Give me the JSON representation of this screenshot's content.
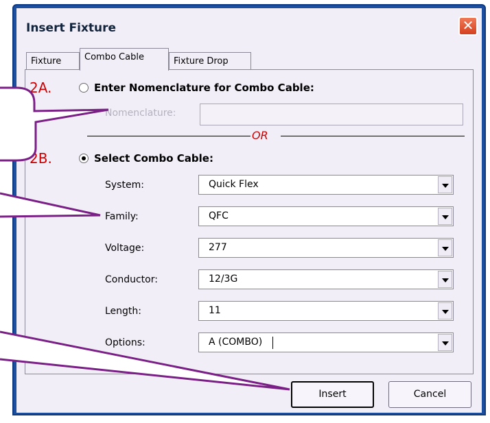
{
  "window": {
    "title": "Insert Fixture",
    "close_glyph": "✕"
  },
  "tabs": [
    {
      "label": "Fixture",
      "active": false
    },
    {
      "label": "Combo Cable",
      "active": true
    },
    {
      "label": "Fixture Drop",
      "active": false
    }
  ],
  "option_a": {
    "step": "2A.",
    "heading": "Enter Nomenclature for Combo Cable:",
    "selected": false,
    "field_label": "Nomenclature:",
    "field_value": ""
  },
  "divider_text": "OR",
  "option_b": {
    "step": "2B.",
    "heading": "Select Combo Cable:",
    "selected": true,
    "fields": [
      {
        "label": "System:",
        "value": "Quick Flex"
      },
      {
        "label": "Family:",
        "value": "QFC"
      },
      {
        "label": "Voltage:",
        "value": "277"
      },
      {
        "label": "Conductor:",
        "value": "12/3G"
      },
      {
        "label": "Length:",
        "value": "11"
      },
      {
        "label": "Options:",
        "value": "A (COMBO)"
      }
    ]
  },
  "buttons": {
    "insert": "Insert",
    "cancel": "Cancel"
  },
  "colors": {
    "accent_red": "#cc0000",
    "frame_blue": "#1c4f9f",
    "callout_stroke": "#7a1f86"
  }
}
